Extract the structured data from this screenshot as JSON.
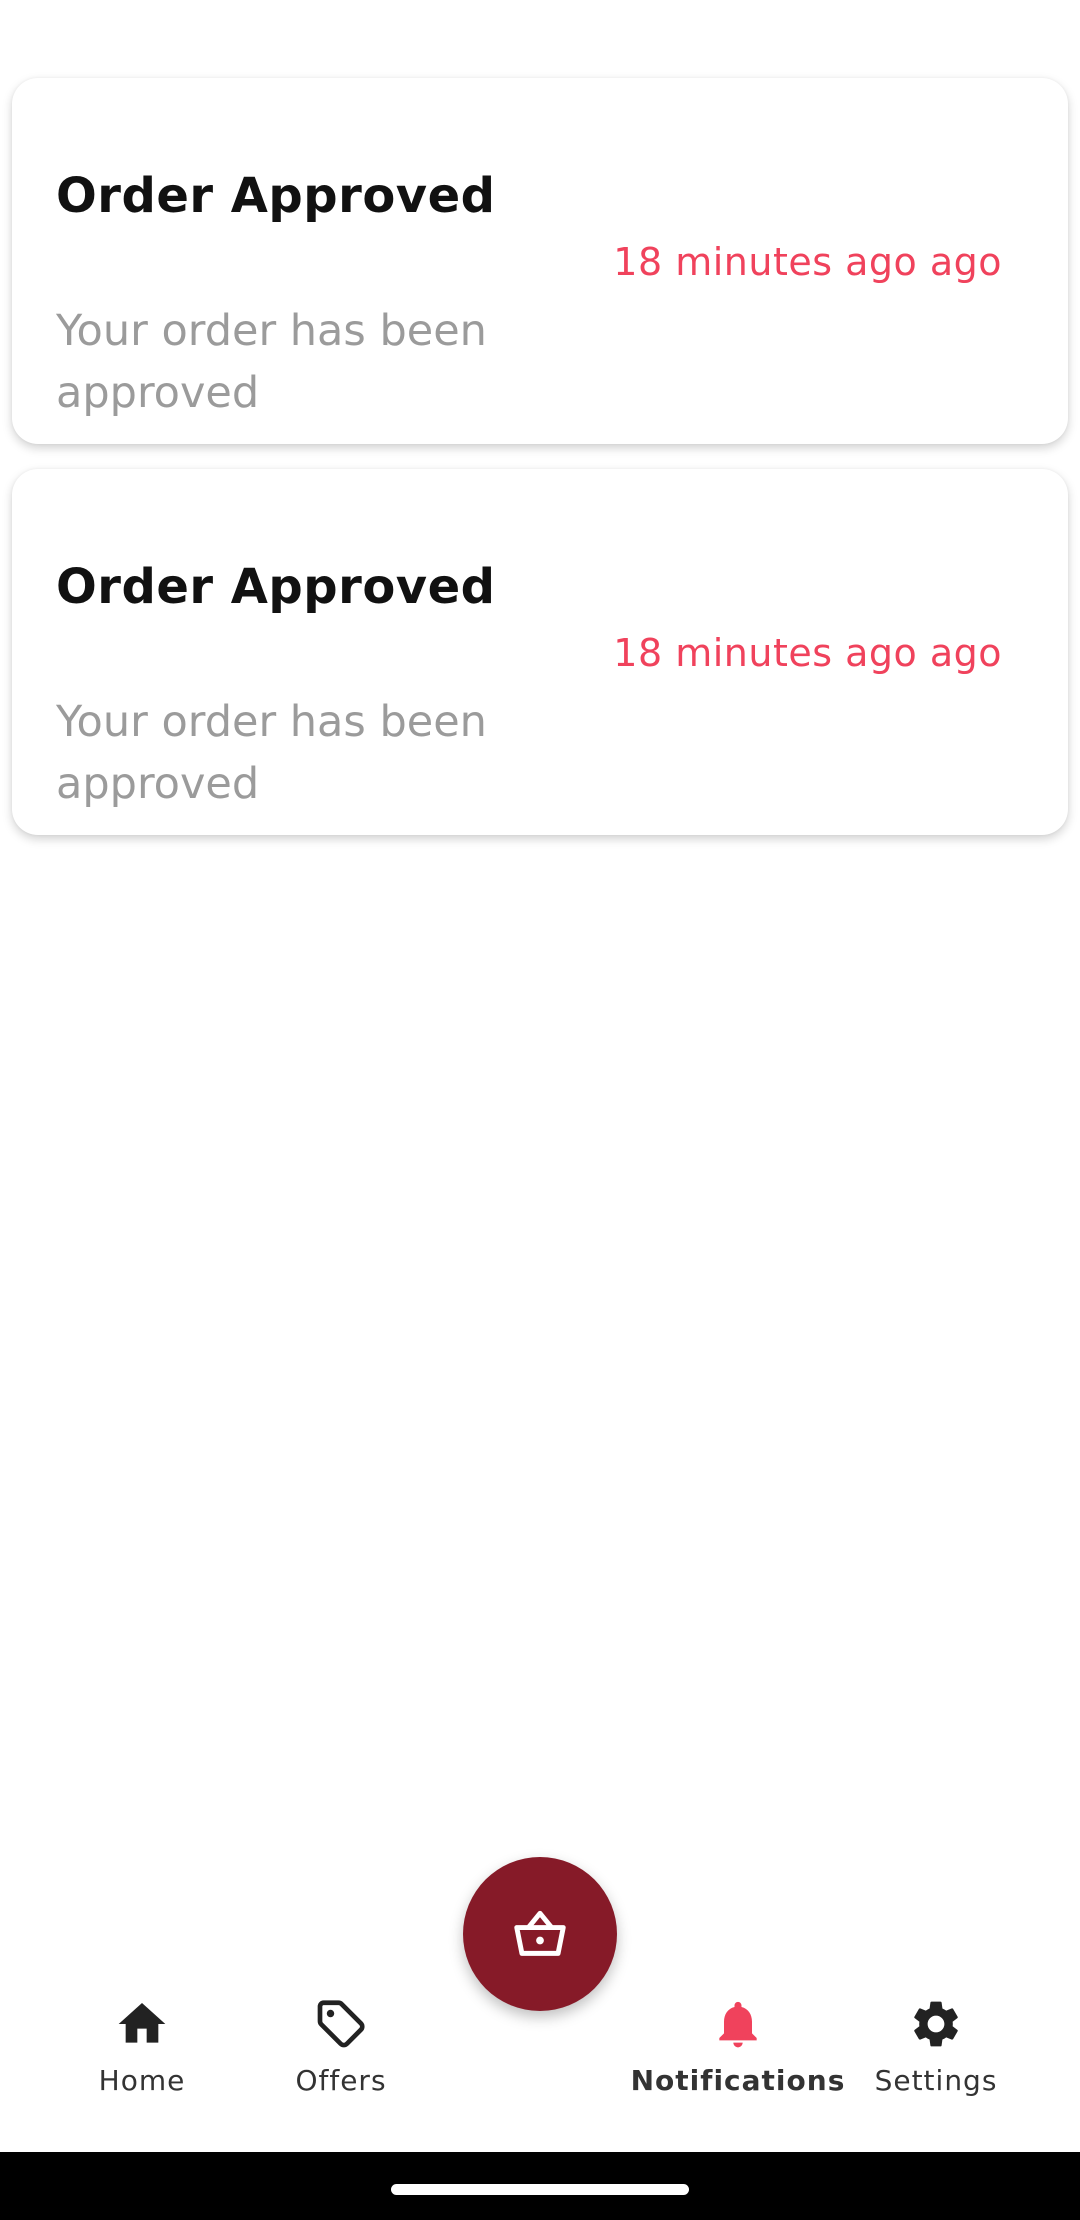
{
  "notifications": [
    {
      "title": "Order Approved",
      "time": "18 minutes ago ago",
      "body": "Your order has been approved"
    },
    {
      "title": "Order Approved",
      "time": "18 minutes ago ago",
      "body": "Your order has been approved"
    }
  ],
  "fab": {
    "icon": "basket-icon",
    "color": "#861a28"
  },
  "nav": {
    "home": {
      "label": "Home",
      "icon": "home-icon"
    },
    "offers": {
      "label": "Offers",
      "icon": "tag-icon"
    },
    "notifications": {
      "label": "Notifications",
      "icon": "bell-icon",
      "active": true
    },
    "settings": {
      "label": "Settings",
      "icon": "gear-icon"
    }
  },
  "colors": {
    "accent": "#f0425c",
    "fab": "#861a28",
    "muted_text": "#9b9b9b"
  }
}
